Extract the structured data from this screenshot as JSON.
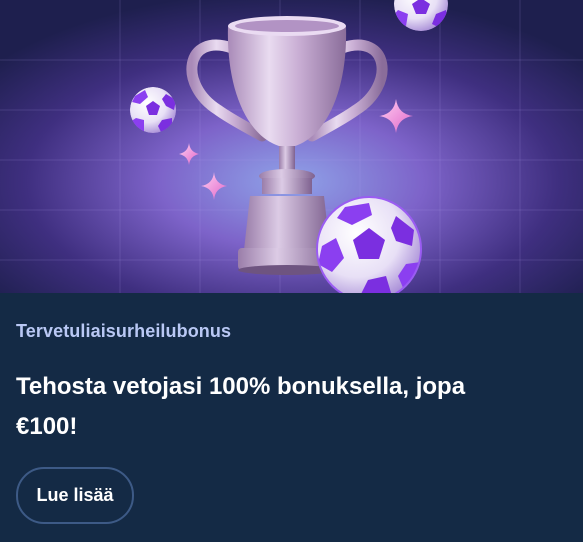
{
  "promo": {
    "category": "Tervetuliaisurheilubonus",
    "headline": "Tehosta vetojasi 100% bonuksella, jopa €100!",
    "cta_label": "Lue lisää",
    "hero_image": "trophy-with-footballs-illustration"
  },
  "colors": {
    "card_background": "#142a45",
    "category_text": "#b9c8f4",
    "headline_text": "#ffffff",
    "button_border": "#3d5a86",
    "accent_purple": "#8b3ff0"
  }
}
